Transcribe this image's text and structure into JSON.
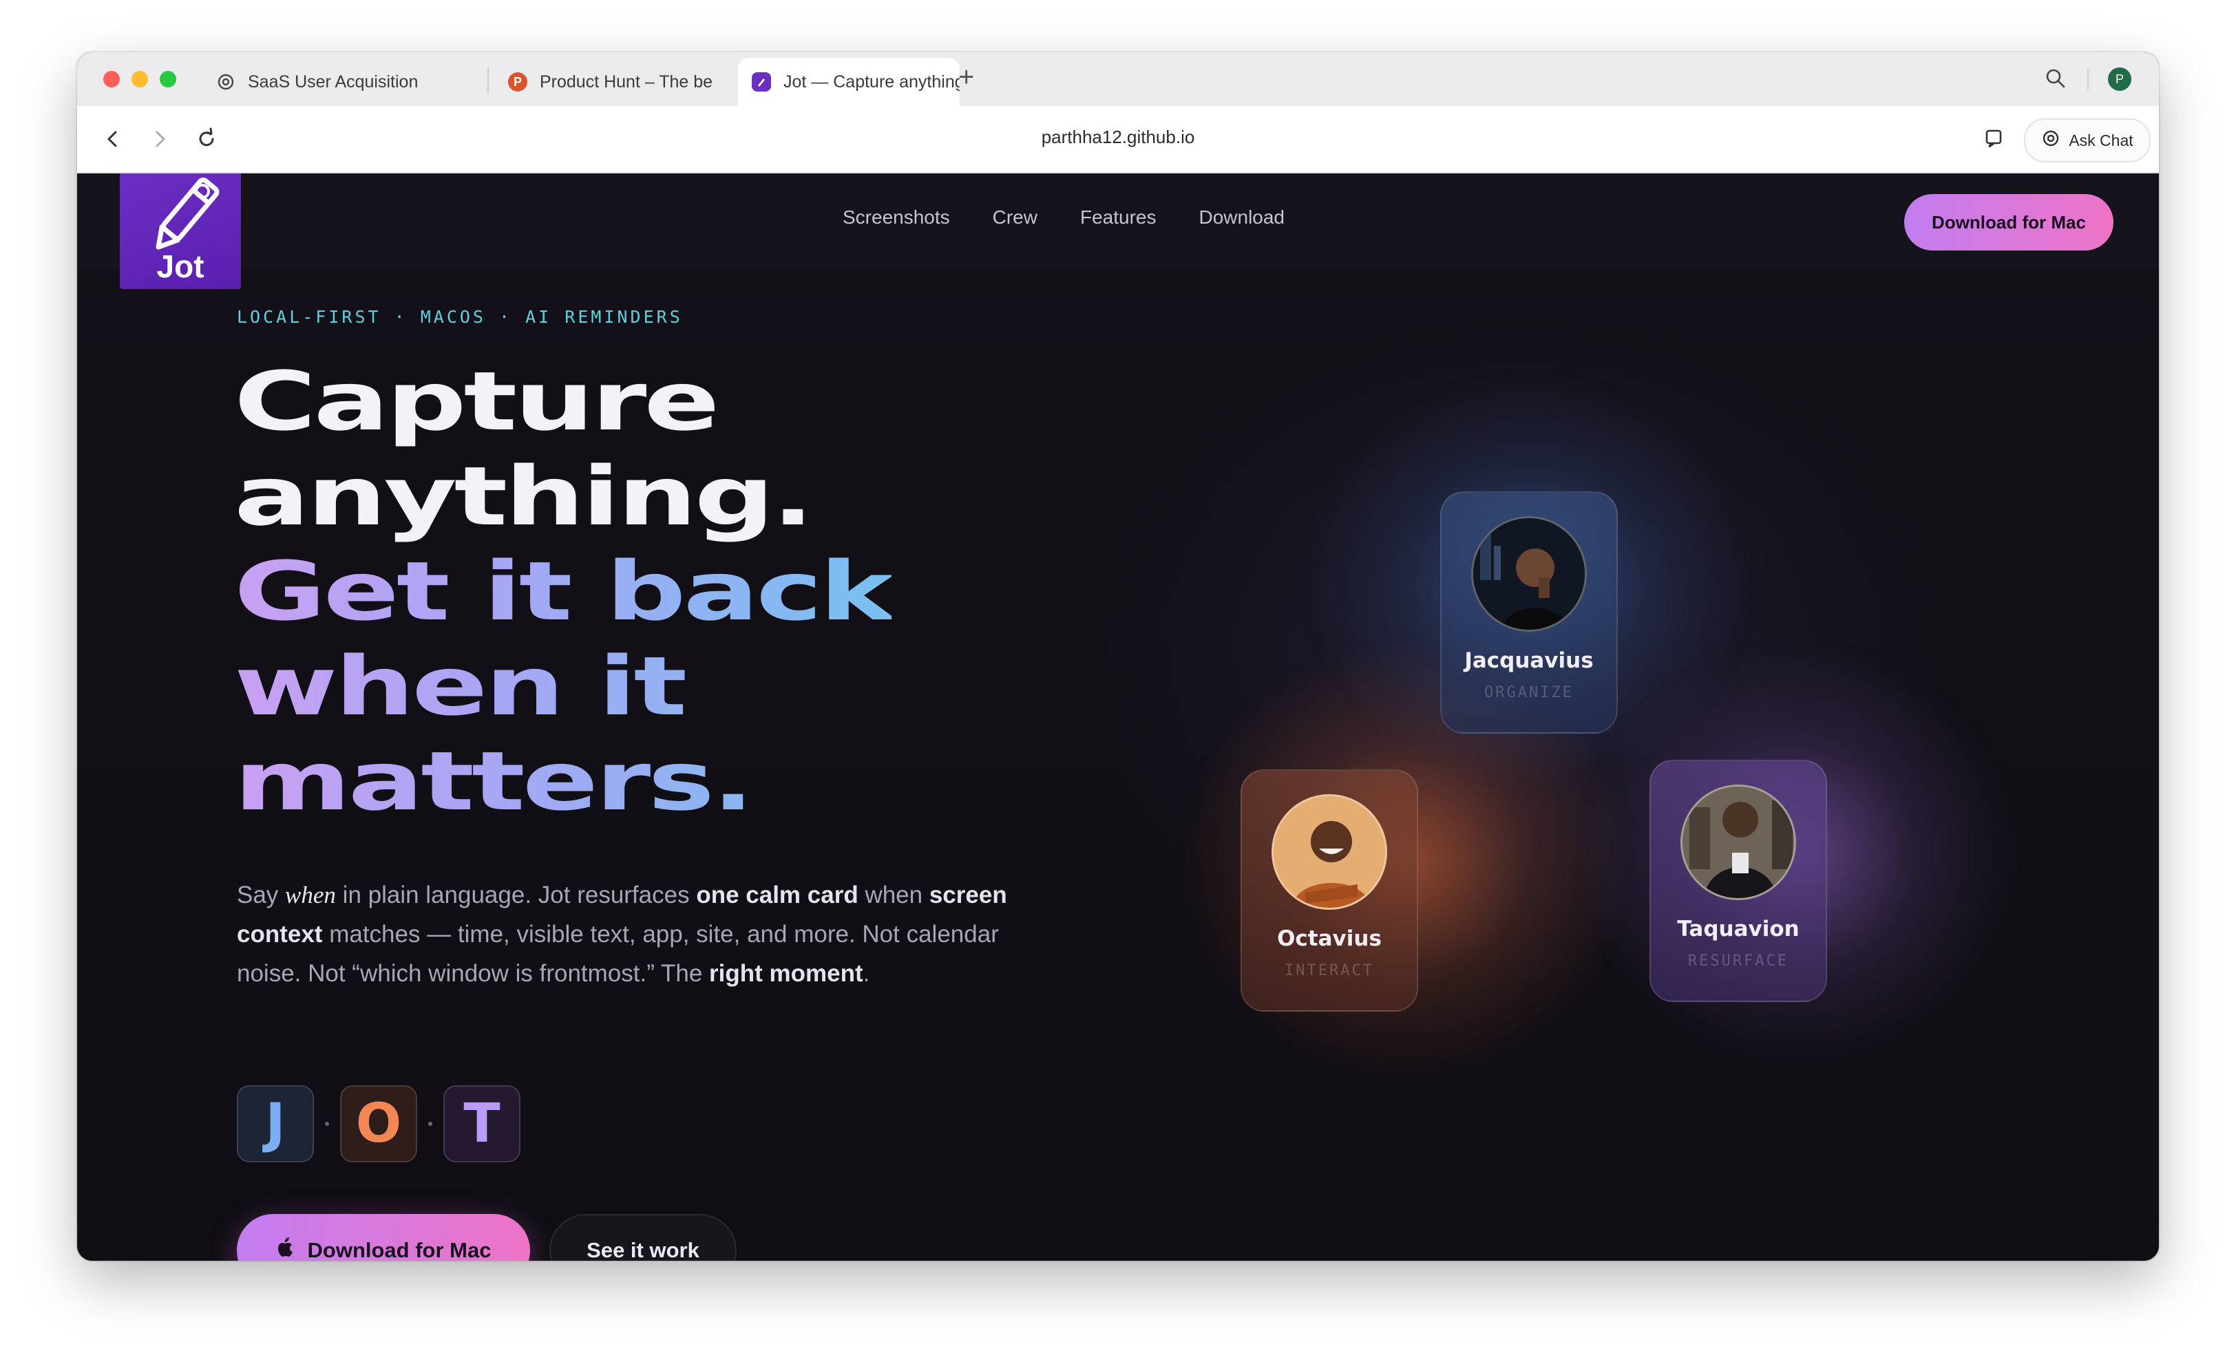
{
  "browser": {
    "tabs": [
      {
        "title": "SaaS User Acquisition",
        "favicon": "openai-icon"
      },
      {
        "title": "Product Hunt – The be",
        "favicon": "product-hunt-icon",
        "favicon_color": "#da552f",
        "favicon_letter": "P"
      },
      {
        "title": "Jot — Capture anything",
        "favicon": "jot-icon",
        "favicon_color": "#6b2fc4",
        "active": true
      }
    ],
    "url": "parthha12.github.io",
    "ask_chat_label": "Ask Chat",
    "profile_initial": "P"
  },
  "site": {
    "logo_text": "Jot",
    "nav": [
      "Screenshots",
      "Crew",
      "Features",
      "Download"
    ],
    "nav_cta": "Download for Mac"
  },
  "hero": {
    "eyebrow": "LOCAL-FIRST · MACOS · AI REMINDERS",
    "headline_white": [
      "Capture",
      "anything."
    ],
    "headline_gradient": [
      "Get it back",
      "when it",
      "matters."
    ],
    "lede": {
      "p1": "Say ",
      "when": "when",
      "p2": " in plain language. Jot resurfaces ",
      "b1": "one calm card",
      "p3": " when ",
      "b2": "screen context",
      "p4": " matches — time, visible text, app, site, and more. Not calendar noise. Not “which window is frontmost.” The ",
      "b3": "right moment",
      "p5": "."
    },
    "letters": [
      {
        "char": "J",
        "color": "#7aaef0",
        "bg": "#1b2334"
      },
      {
        "char": "O",
        "color": "#f28654",
        "bg": "#2e1d19"
      },
      {
        "char": "T",
        "color": "#b99cf5",
        "bg": "#24192f"
      }
    ],
    "primary_cta": "Download for Mac",
    "secondary_cta": "See it work"
  },
  "crew": [
    {
      "name": "Jacquavius",
      "role": "ORGANIZE",
      "accent": "#3b6fc0"
    },
    {
      "name": "Octavius",
      "role": "INTERACT",
      "accent": "#e06a3a"
    },
    {
      "name": "Taquavion",
      "role": "RESURFACE",
      "accent": "#9a6ad8"
    }
  ],
  "colors": {
    "accent_gradient_start": "#c27df0",
    "accent_gradient_end": "#ee74c6",
    "eyebrow": "#5fd0e0",
    "page_bg": "#100e14"
  }
}
